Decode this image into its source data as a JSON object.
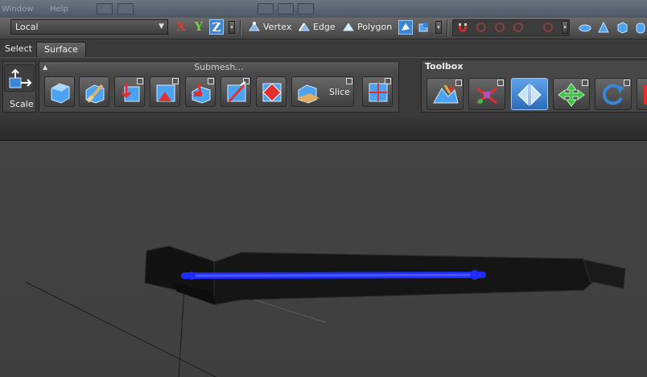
{
  "titlebar": {
    "faded_labels": [
      "Window",
      "Help"
    ]
  },
  "toolbar": {
    "coord_space": "Local",
    "axes": {
      "x": "X",
      "y": "Y",
      "z": "Z"
    },
    "selection_modes": {
      "vertex": "Vertex",
      "edge": "Edge",
      "polygon": "Polygon"
    }
  },
  "tabs": {
    "select": "Select",
    "surface": "Surface"
  },
  "ribbon": {
    "scale_label": "Scale",
    "submesh_title": "Submesh...",
    "slice_label": "Slice",
    "toolbox_title": "Toolbox"
  },
  "colors": {
    "accent": "#3a86d6",
    "axis_x": "#e23a2a",
    "axis_y": "#6fd13c",
    "highlight_blue": "#1e2cff"
  }
}
